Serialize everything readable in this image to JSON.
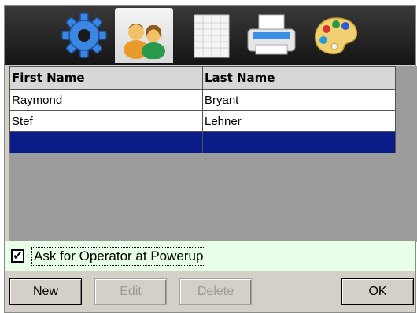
{
  "toolbar": {
    "icons": [
      "gear-icon",
      "users-icon",
      "calendar-icon",
      "printer-icon",
      "palette-icon"
    ],
    "selected": "users-icon"
  },
  "grid": {
    "columns": [
      "First Name",
      "Last Name"
    ],
    "rows": [
      [
        "Raymond",
        "Bryant"
      ],
      [
        "Stef",
        "Lehner"
      ],
      [
        "",
        ""
      ]
    ],
    "selected_row": 2
  },
  "option": {
    "label": "Ask for Operator at Powerup",
    "checked": true,
    "check_glyph": "✔"
  },
  "buttons": {
    "new_label": "New",
    "edit_label": "Edit",
    "delete_label": "Delete",
    "ok_label": "OK"
  },
  "colors": {
    "selection": "#0a1c87",
    "toolbar_bg": "#1e1e1e",
    "option_bg": "#e8ffe8"
  }
}
